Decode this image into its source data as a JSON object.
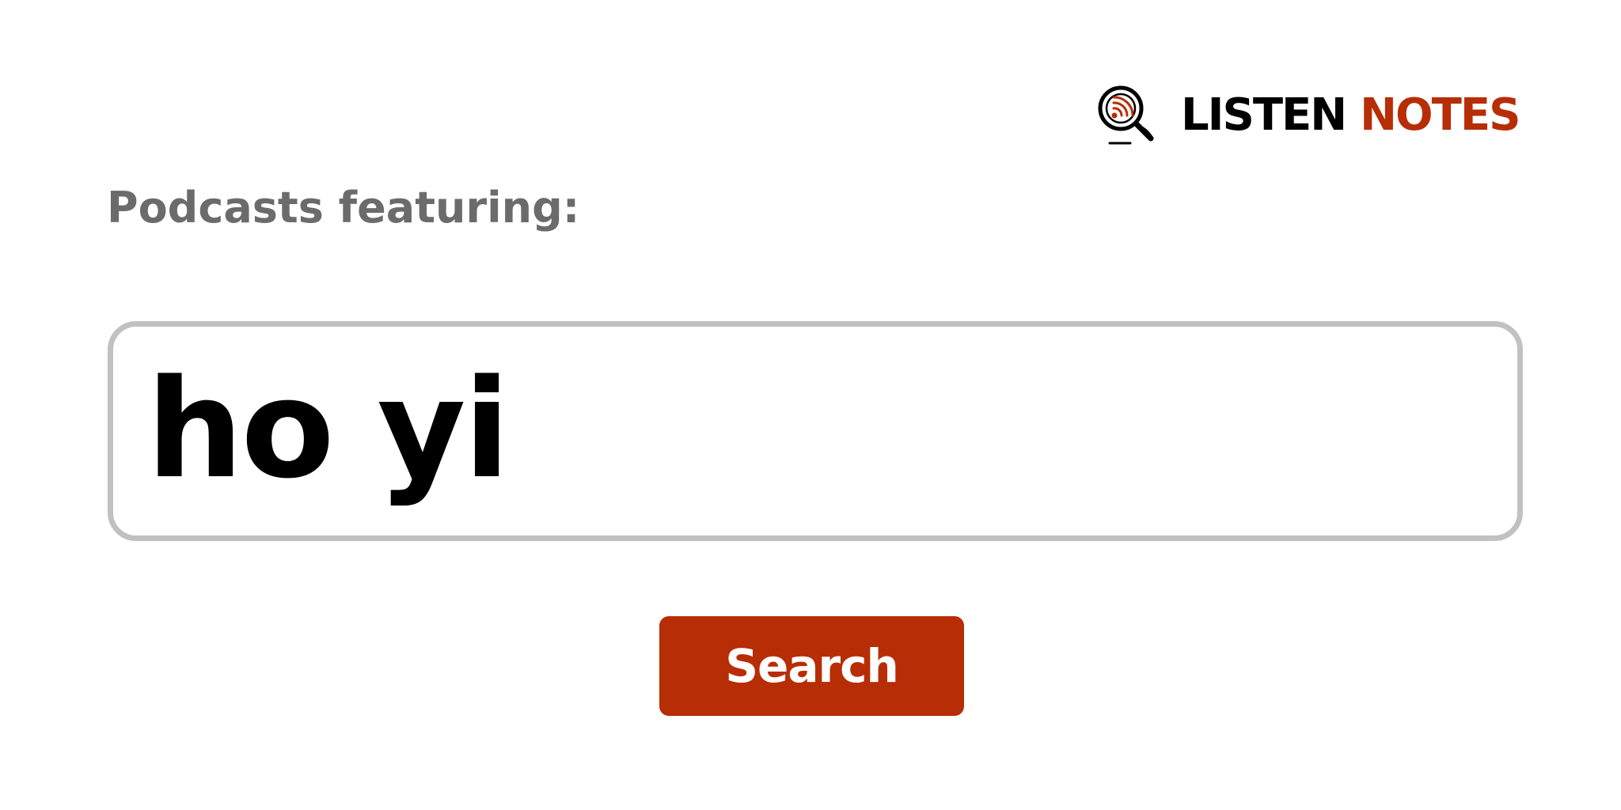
{
  "brand": {
    "name_part1": "LISTEN",
    "name_part2": "NOTES",
    "icon": "podcast-search-icon",
    "colors": {
      "primary": "#000000",
      "accent": "#b72d05"
    }
  },
  "heading": {
    "text": "Podcasts featuring:"
  },
  "search": {
    "value": "ho yi"
  },
  "button": {
    "label": "Search",
    "color": "#b72d05"
  }
}
